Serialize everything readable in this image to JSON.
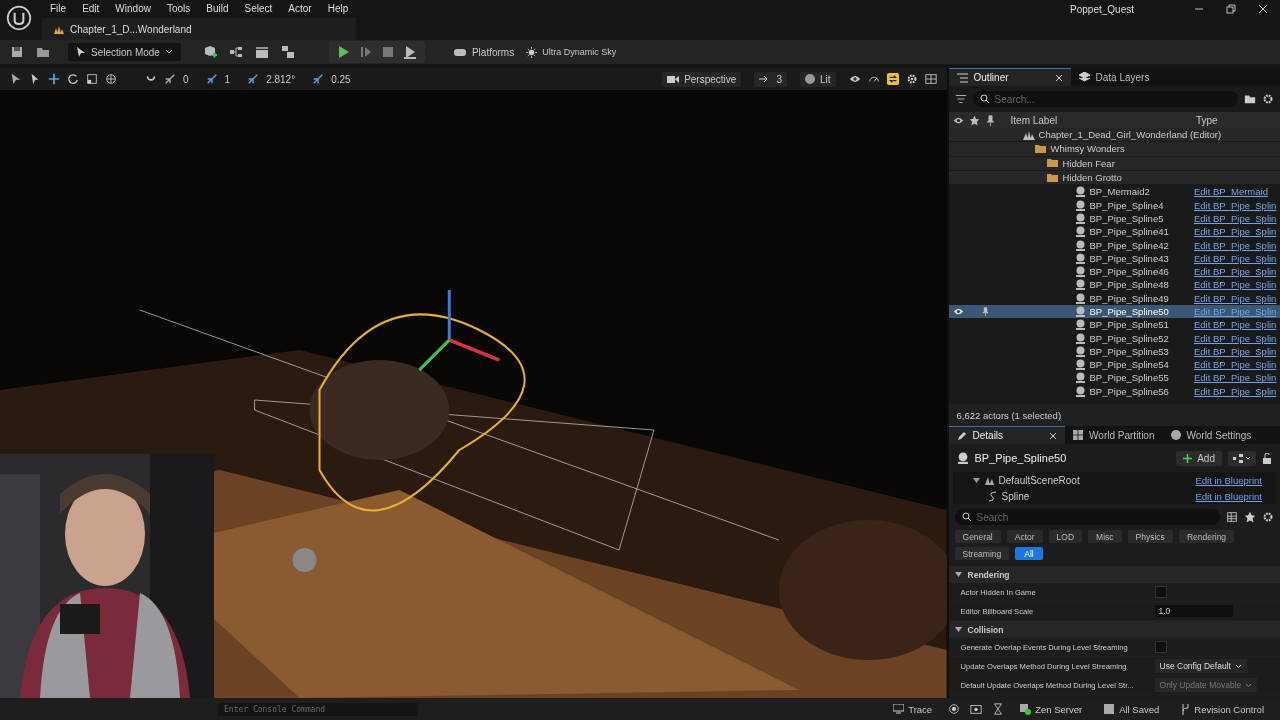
{
  "window": {
    "title": "Poppet_Quest",
    "menu": [
      "File",
      "Edit",
      "Window",
      "Tools",
      "Build",
      "Select",
      "Actor",
      "Help"
    ],
    "level_tab": "Chapter_1_D...Wonderland"
  },
  "toolbar": {
    "selection_mode": "Selection Mode",
    "platforms": "Platforms",
    "sky": "Ultra Dynamic Sky"
  },
  "viewport_toolbar": {
    "snaps": [
      "0",
      "1",
      "2.812°",
      "0.25"
    ],
    "view": "Perspective",
    "speed": "3",
    "lighting": "Lit"
  },
  "outliner": {
    "tabs": [
      {
        "label": "Outliner",
        "selected": true
      },
      {
        "label": "Data Layers",
        "selected": false
      }
    ],
    "search": {
      "placeholder": "Search..."
    },
    "columns": [
      "Item Label",
      "Type"
    ],
    "tree": [
      {
        "kind": "level",
        "label": "Chapter_1_Dead_Girl_Wonderland (Editor)",
        "selected": false,
        "children": [
          {
            "kind": "folder",
            "label": "Whimsy Wonders",
            "selected": false,
            "children": [
              {
                "kind": "folder",
                "label": "Hidden Fear",
                "selected": false
              },
              {
                "kind": "folder",
                "label": "Hidden Grotto",
                "selected": false,
                "children": [
                  {
                    "kind": "actor",
                    "label": "BP_Mermaid2",
                    "type": "Edit BP_Mermaid",
                    "selected": false
                  },
                  {
                    "kind": "actor",
                    "label": "BP_Pipe_Spline4",
                    "type": "Edit BP_Pipe_Splin",
                    "selected": false
                  },
                  {
                    "kind": "actor",
                    "label": "BP_Pipe_Spline5",
                    "type": "Edit BP_Pipe_Splin",
                    "selected": false
                  },
                  {
                    "kind": "actor",
                    "label": "BP_Pipe_Spline41",
                    "type": "Edit BP_Pipe_Splin",
                    "selected": false
                  },
                  {
                    "kind": "actor",
                    "label": "BP_Pipe_Spline42",
                    "type": "Edit BP_Pipe_Splin",
                    "selected": false
                  },
                  {
                    "kind": "actor",
                    "label": "BP_Pipe_Spline43",
                    "type": "Edit BP_Pipe_Splin",
                    "selected": false
                  },
                  {
                    "kind": "actor",
                    "label": "BP_Pipe_Spline46",
                    "type": "Edit BP_Pipe_Splin",
                    "selected": false
                  },
                  {
                    "kind": "actor",
                    "label": "BP_Pipe_Spline48",
                    "type": "Edit BP_Pipe_Splin",
                    "selected": false
                  },
                  {
                    "kind": "actor",
                    "label": "BP_Pipe_Spline49",
                    "type": "Edit BP_Pipe_Splin",
                    "selected": false
                  },
                  {
                    "kind": "actor",
                    "label": "BP_Pipe_Spline50",
                    "type": "Edit BP_Pipe_Splin",
                    "selected": true
                  },
                  {
                    "kind": "actor",
                    "label": "BP_Pipe_Spline51",
                    "type": "Edit BP_Pipe_Splin",
                    "selected": false
                  },
                  {
                    "kind": "actor",
                    "label": "BP_Pipe_Spline52",
                    "type": "Edit BP_Pipe_Splin",
                    "selected": false
                  },
                  {
                    "kind": "actor",
                    "label": "BP_Pipe_Spline53",
                    "type": "Edit BP_Pipe_Splin",
                    "selected": false
                  },
                  {
                    "kind": "actor",
                    "label": "BP_Pipe_Spline54",
                    "type": "Edit BP_Pipe_Splin",
                    "selected": false
                  },
                  {
                    "kind": "actor",
                    "label": "BP_Pipe_Spline55",
                    "type": "Edit BP_Pipe_Splin",
                    "selected": false
                  },
                  {
                    "kind": "actor",
                    "label": "BP_Pipe_Spline56",
                    "type": "Edit BP_Pipe_Splin",
                    "selected": false
                  }
                ]
              }
            ]
          }
        ]
      }
    ],
    "footer": "6,622 actors (1 selected)"
  },
  "details": {
    "tabs": [
      {
        "label": "Details",
        "selected": true
      },
      {
        "label": "World Partition",
        "selected": false
      },
      {
        "label": "World Settings",
        "selected": false
      }
    ],
    "actor_name": "BP_Pipe_Spline50",
    "add_button": "Add",
    "components": [
      {
        "label": "DefaultSceneRoot",
        "link": "Edit in Blueprint",
        "children": [
          {
            "label": "Spline",
            "link": "Edit in Blueprint"
          }
        ]
      }
    ],
    "search": {
      "placeholder": "Search"
    },
    "filters": [
      {
        "label": "General",
        "selected": false
      },
      {
        "label": "Actor",
        "selected": false
      },
      {
        "label": "LOD",
        "selected": false
      },
      {
        "label": "Misc",
        "selected": false
      },
      {
        "label": "Physics",
        "selected": false
      },
      {
        "label": "Rendering",
        "selected": false
      },
      {
        "label": "Streaming",
        "selected": false
      },
      {
        "label": "All",
        "selected": true
      }
    ],
    "sections": [
      {
        "title": "Rendering",
        "expanded": true,
        "rows": [
          {
            "kind": "checkbox",
            "label": "Actor Hidden In Game",
            "checked": false
          },
          {
            "kind": "number",
            "label": "Editor Billboard Scale",
            "value": "1.0"
          }
        ]
      },
      {
        "title": "Collision",
        "expanded": true,
        "rows": [
          {
            "kind": "checkbox",
            "label": "Generate Overlap Events During Level Streaming",
            "checked": false
          },
          {
            "kind": "dropdown",
            "label": "Update Overlaps Method During Level Streaming",
            "value": "Use Config Default",
            "disabled": false
          },
          {
            "kind": "dropdown",
            "label": "Default Update Overlaps Method During Level Str...",
            "value": "Only Update Movable",
            "disabled": true
          }
        ]
      }
    ]
  },
  "status_bar": {
    "console": {
      "placeholder": "Enter Console Command"
    },
    "trace": "Trace",
    "server": "Zen Server",
    "saved": "All Saved",
    "revision": "Revision Control"
  }
}
